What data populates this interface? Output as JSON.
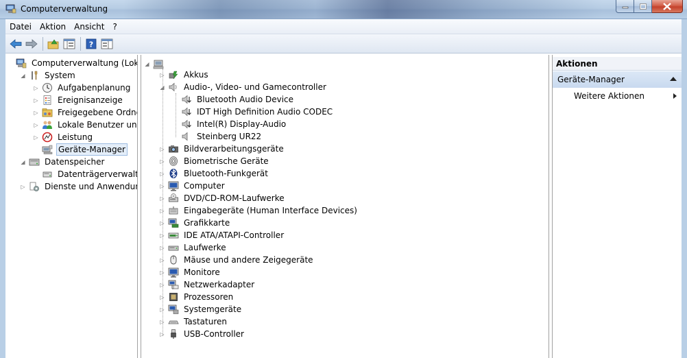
{
  "window": {
    "title": "Computerverwaltung"
  },
  "menu": [
    "Datei",
    "Aktion",
    "Ansicht",
    "?"
  ],
  "left_tree": [
    {
      "label": "Computerverwaltung (Lokal)",
      "level": 0,
      "expander": "none",
      "icon": "computer-management-icon"
    },
    {
      "label": "System",
      "level": 1,
      "expander": "expanded",
      "icon": "tools-icon"
    },
    {
      "label": "Aufgabenplanung",
      "level": 2,
      "expander": "collapsed",
      "icon": "clock-icon"
    },
    {
      "label": "Ereignisanzeige",
      "level": 2,
      "expander": "collapsed",
      "icon": "event-log-icon"
    },
    {
      "label": "Freigegebene Ordner",
      "level": 2,
      "expander": "collapsed",
      "icon": "shared-folder-icon"
    },
    {
      "label": "Lokale Benutzer und Gr",
      "level": 2,
      "expander": "collapsed",
      "icon": "users-icon"
    },
    {
      "label": "Leistung",
      "level": 2,
      "expander": "collapsed",
      "icon": "performance-icon"
    },
    {
      "label": "Geräte-Manager",
      "level": 2,
      "expander": "none",
      "icon": "device-manager-icon",
      "selected": true
    },
    {
      "label": "Datenspeicher",
      "level": 1,
      "expander": "expanded",
      "icon": "storage-icon"
    },
    {
      "label": "Datenträgerverwaltung",
      "level": 2,
      "expander": "none",
      "icon": "disk-icon"
    },
    {
      "label": "Dienste und Anwendungen",
      "level": 1,
      "expander": "collapsed",
      "icon": "services-icon"
    }
  ],
  "device_tree": [
    {
      "label": "Akkus",
      "level": 1,
      "expander": "collapsed",
      "icon": "battery-icon"
    },
    {
      "label": "Audio-, Video- und Gamecontroller",
      "level": 1,
      "expander": "expanded",
      "icon": "speaker-icon"
    },
    {
      "label": "Bluetooth Audio Device",
      "level": 2,
      "expander": "none",
      "icon": "speaker-device-icon"
    },
    {
      "label": "IDT High Definition Audio CODEC",
      "level": 2,
      "expander": "none",
      "icon": "speaker-device-icon"
    },
    {
      "label": "Intel(R) Display-Audio",
      "level": 2,
      "expander": "none",
      "icon": "speaker-device-icon"
    },
    {
      "label": "Steinberg UR22",
      "level": 2,
      "expander": "none",
      "icon": "speaker-plain-icon"
    },
    {
      "label": "Bildverarbeitungsgeräte",
      "level": 1,
      "expander": "collapsed",
      "icon": "camera-icon"
    },
    {
      "label": "Biometrische Geräte",
      "level": 1,
      "expander": "collapsed",
      "icon": "fingerprint-icon"
    },
    {
      "label": "Bluetooth-Funkgerät",
      "level": 1,
      "expander": "collapsed",
      "icon": "bluetooth-icon"
    },
    {
      "label": "Computer",
      "level": 1,
      "expander": "collapsed",
      "icon": "monitor-icon"
    },
    {
      "label": "DVD/CD-ROM-Laufwerke",
      "level": 1,
      "expander": "collapsed",
      "icon": "dvd-drive-icon"
    },
    {
      "label": "Eingabegeräte (Human Interface Devices)",
      "level": 1,
      "expander": "collapsed",
      "icon": "hid-icon"
    },
    {
      "label": "Grafikkarte",
      "level": 1,
      "expander": "collapsed",
      "icon": "display-adapter-icon"
    },
    {
      "label": "IDE ATA/ATAPI-Controller",
      "level": 1,
      "expander": "collapsed",
      "icon": "ide-controller-icon"
    },
    {
      "label": "Laufwerke",
      "level": 1,
      "expander": "collapsed",
      "icon": "drive-icon"
    },
    {
      "label": "Mäuse und andere Zeigegeräte",
      "level": 1,
      "expander": "collapsed",
      "icon": "mouse-icon"
    },
    {
      "label": "Monitore",
      "level": 1,
      "expander": "collapsed",
      "icon": "monitor-icon"
    },
    {
      "label": "Netzwerkadapter",
      "level": 1,
      "expander": "collapsed",
      "icon": "network-adapter-icon"
    },
    {
      "label": "Prozessoren",
      "level": 1,
      "expander": "collapsed",
      "icon": "processor-icon"
    },
    {
      "label": "Systemgeräte",
      "level": 1,
      "expander": "collapsed",
      "icon": "system-device-icon"
    },
    {
      "label": "Tastaturen",
      "level": 1,
      "expander": "collapsed",
      "icon": "keyboard-icon"
    },
    {
      "label": "USB-Controller",
      "level": 1,
      "expander": "collapsed",
      "icon": "usb-icon"
    }
  ],
  "actions": {
    "header": "Aktionen",
    "section": "Geräte-Manager",
    "item": "Weitere Aktionen"
  }
}
